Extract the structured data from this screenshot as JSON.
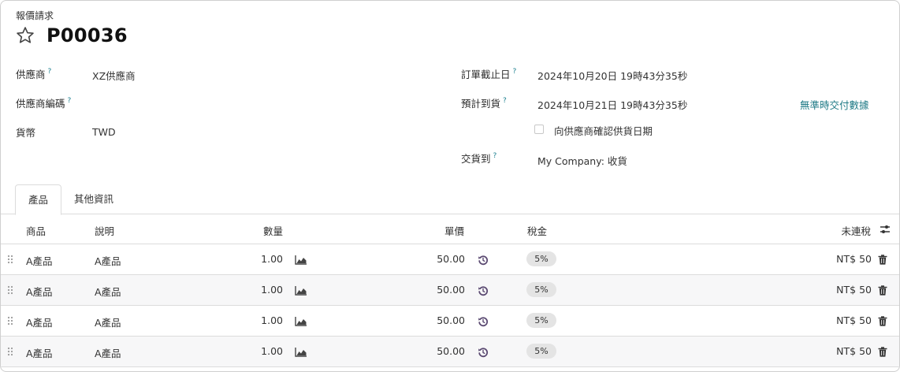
{
  "breadcrumb": "報價請求",
  "title": "P00036",
  "icons": {
    "favorite": "star-icon",
    "settings": "sliders-icon",
    "drag": "drag-handle-icon",
    "forecast": "area-chart-icon",
    "reset": "history-icon",
    "delete": "trash-icon"
  },
  "fields": {
    "vendor": {
      "label": "供應商",
      "value": "XZ供應商"
    },
    "vendor_ref": {
      "label": "供應商編碼",
      "value": ""
    },
    "currency": {
      "label": "貨幣",
      "value": "TWD"
    },
    "order_deadline": {
      "label": "訂單截止日",
      "value": "2024年10月20日 19時43分35秒"
    },
    "expected_arrival": {
      "label": "預計到貨",
      "value": "2024年10月21日 19時43分35秒"
    },
    "on_time_link": "無準時交付數據",
    "confirm_date_label": "向供應商確認供貨日期",
    "deliver_to": {
      "label": "交貨到",
      "value": "My Company: 收貨"
    }
  },
  "tooltip_mark": "?",
  "tabs": [
    {
      "label": "產品"
    },
    {
      "label": "其他資訊"
    }
  ],
  "table": {
    "headers": {
      "product": "商品",
      "description": "說明",
      "quantity": "數量",
      "unit_price": "單價",
      "taxes": "稅金",
      "subtotal": "未連稅"
    },
    "rows": [
      {
        "product": "A產品",
        "description": "A產品",
        "quantity": "1.00",
        "unit_price": "50.00",
        "tax": "5%",
        "subtotal": "NT$ 50"
      },
      {
        "product": "A產品",
        "description": "A產品",
        "quantity": "1.00",
        "unit_price": "50.00",
        "tax": "5%",
        "subtotal": "NT$ 50"
      },
      {
        "product": "A產品",
        "description": "A產品",
        "quantity": "1.00",
        "unit_price": "50.00",
        "tax": "5%",
        "subtotal": "NT$ 50"
      },
      {
        "product": "A產品",
        "description": "A產品",
        "quantity": "1.00",
        "unit_price": "50.00",
        "tax": "5%",
        "subtotal": "NT$ 50"
      }
    ]
  },
  "colors": {
    "link": "#1f7a86",
    "icon": "#5b4a72",
    "badge_bg": "#e4e4e4"
  }
}
